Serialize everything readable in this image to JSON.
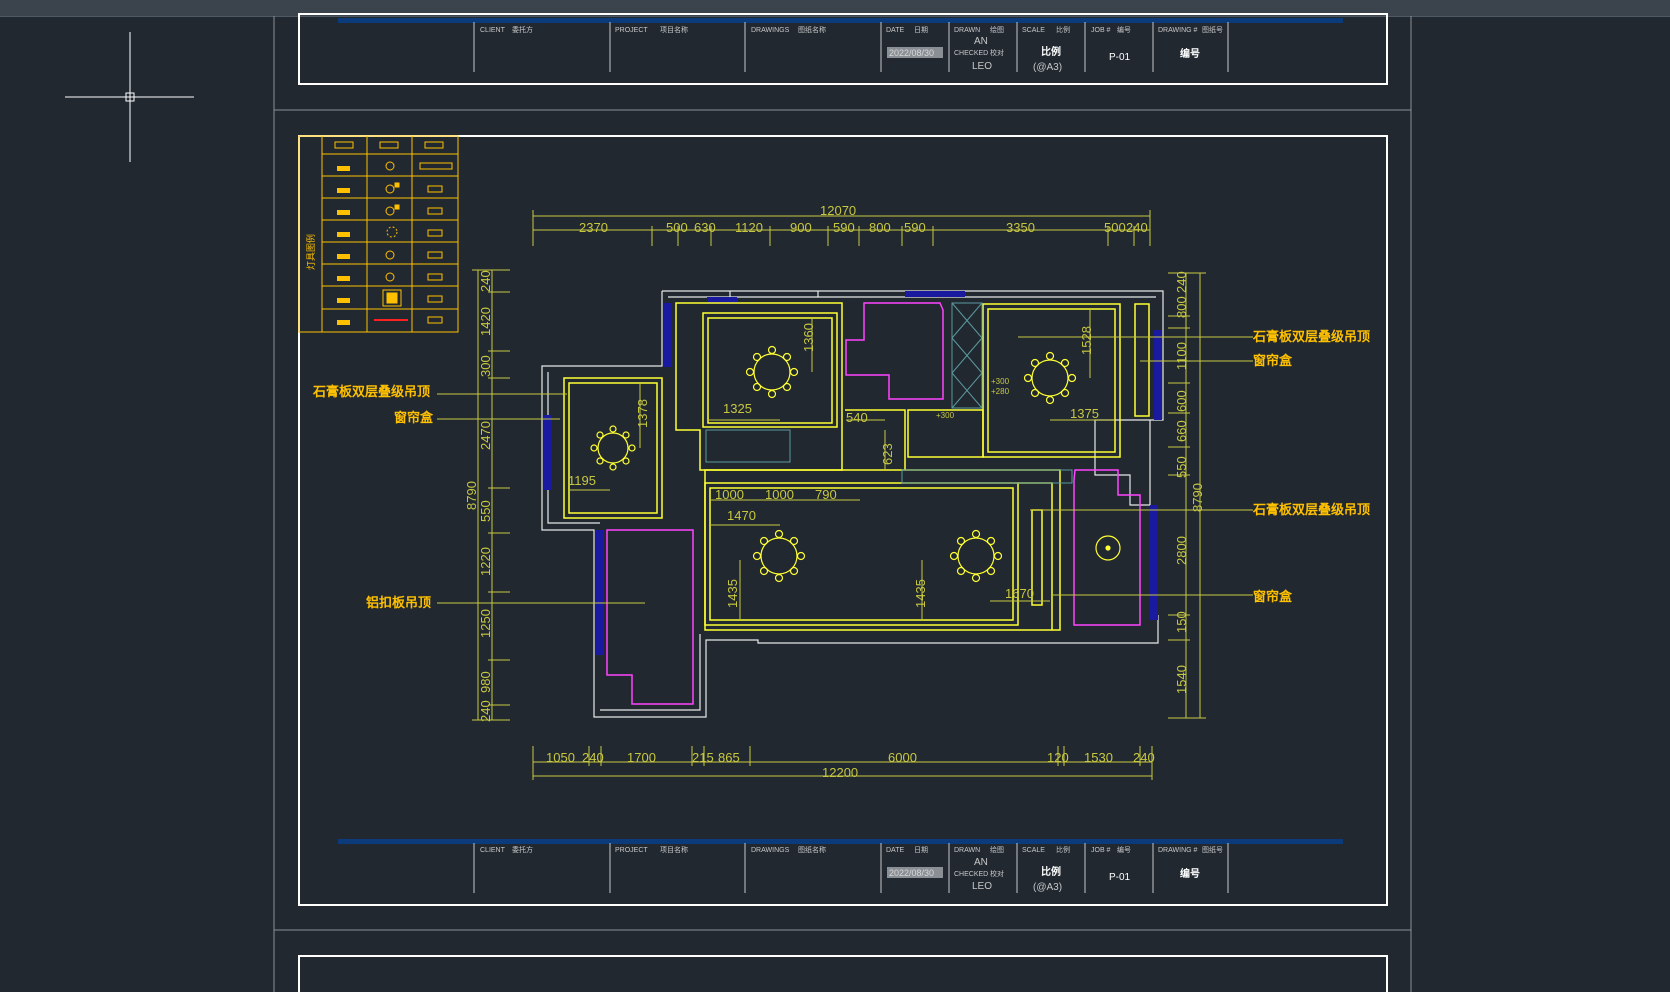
{
  "colors": {
    "background": "#212830",
    "sheet_border": "#ffffff",
    "dimension": "#c8c840",
    "wall": "#ffffff",
    "ceiling_outline": "#ffff33",
    "magenta": "#ff44ff",
    "window_fill": "#1a1aa0",
    "label": "#ffc000",
    "legend": "#ffc000",
    "title_bar": "#0b3b7a"
  },
  "title_block": {
    "client_label": "CLIENT",
    "client_cn": "委托方",
    "project_label": "PROJECT",
    "project_cn": "项目名称",
    "drawings_label": "DRAWINGS",
    "drawings_cn": "图纸名称",
    "date_label": "DATE",
    "date_cn": "日期",
    "date_value": "2022/08/30",
    "drawn_label": "DRAWN",
    "drawn_cn": "绘图",
    "drawn_by": "AN",
    "checked_label": "CHECKED",
    "checked_cn": "校对",
    "checked_by": "LEO",
    "scale_label": "SCALE",
    "scale_cn": "比例",
    "scale_value": "比例",
    "scale_paper": "(@A3)",
    "job_label": "JOB #",
    "job_cn": "编号",
    "job_value": "P-01",
    "drawing_no_label": "DRAWING #",
    "drawing_no_cn": "图纸号",
    "drawing_no_value": "编号"
  },
  "legend": {
    "title": "灯具图例"
  },
  "top_dims": {
    "overall": "12070",
    "segments": [
      "2370",
      "500",
      "630",
      "1120",
      "900",
      "590",
      "800",
      "590",
      "3350",
      "500",
      "240"
    ]
  },
  "bottom_dims": {
    "overall": "12200",
    "segments": [
      "1050",
      "240",
      "1700",
      "215",
      "865",
      "6000",
      "120",
      "1530",
      "240"
    ]
  },
  "left_dims": {
    "overall": "8790",
    "segments": [
      "240",
      "1420",
      "300",
      "2470",
      "550",
      "1220",
      "1250",
      "980",
      "240"
    ]
  },
  "right_dims": {
    "overall": "8790",
    "segments": [
      "800",
      "240",
      "1100",
      "600",
      "660",
      "550",
      "2800",
      "150",
      "1540"
    ]
  },
  "room_dims": {
    "d1360": "1360",
    "d1325": "1325",
    "d1378": "1378",
    "d1195": "1195",
    "d540": "540",
    "d623": "623",
    "d1528": "1528",
    "d1375": "1375",
    "d1000a": "1000",
    "d1000b": "1000",
    "d790": "790",
    "d1470": "1470",
    "d1435a": "1435",
    "d1435b": "1435",
    "d1670": "1670",
    "p300a": "+300",
    "p280": "+280",
    "p300b": "+300"
  },
  "annotations": {
    "left_gypsum": "石膏板双层叠级吊顶",
    "left_curtain": "窗帘盒",
    "left_aluminum": "铝扣板吊顶",
    "right_gypsum_top": "石膏板双层叠级吊顶",
    "right_curtain_top": "窗帘盒",
    "right_gypsum_mid": "石膏板双层叠级吊顶",
    "right_curtain_bottom": "窗帘盒"
  }
}
